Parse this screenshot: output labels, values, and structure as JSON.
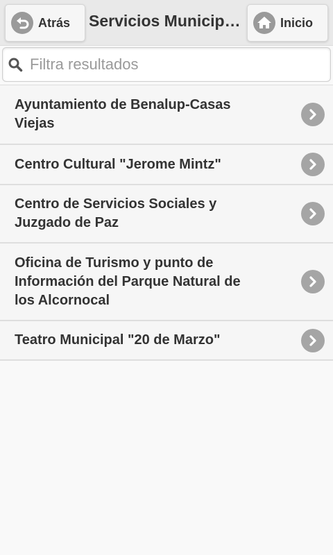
{
  "header": {
    "back_label": "Atrás",
    "home_label": "Inicio",
    "title": "Servicios Municipales"
  },
  "search": {
    "placeholder": "Filtra resultados",
    "value": ""
  },
  "list": {
    "items": [
      {
        "label": "Ayuntamiento de Benalup-Casas Viejas"
      },
      {
        "label": "Centro Cultural \"Jerome Mintz\""
      },
      {
        "label": "Centro de Servicios Sociales y Juzgado de Paz"
      },
      {
        "label": "Oficina de Turismo y punto de Información del Parque Natural de los Alcornocal"
      },
      {
        "label": "Teatro Municipal \"20 de Marzo\""
      }
    ]
  },
  "icons": {
    "back": "back-arrow-icon",
    "home": "home-icon",
    "search": "search-icon",
    "item_arrow": "chevron-right-icon"
  }
}
